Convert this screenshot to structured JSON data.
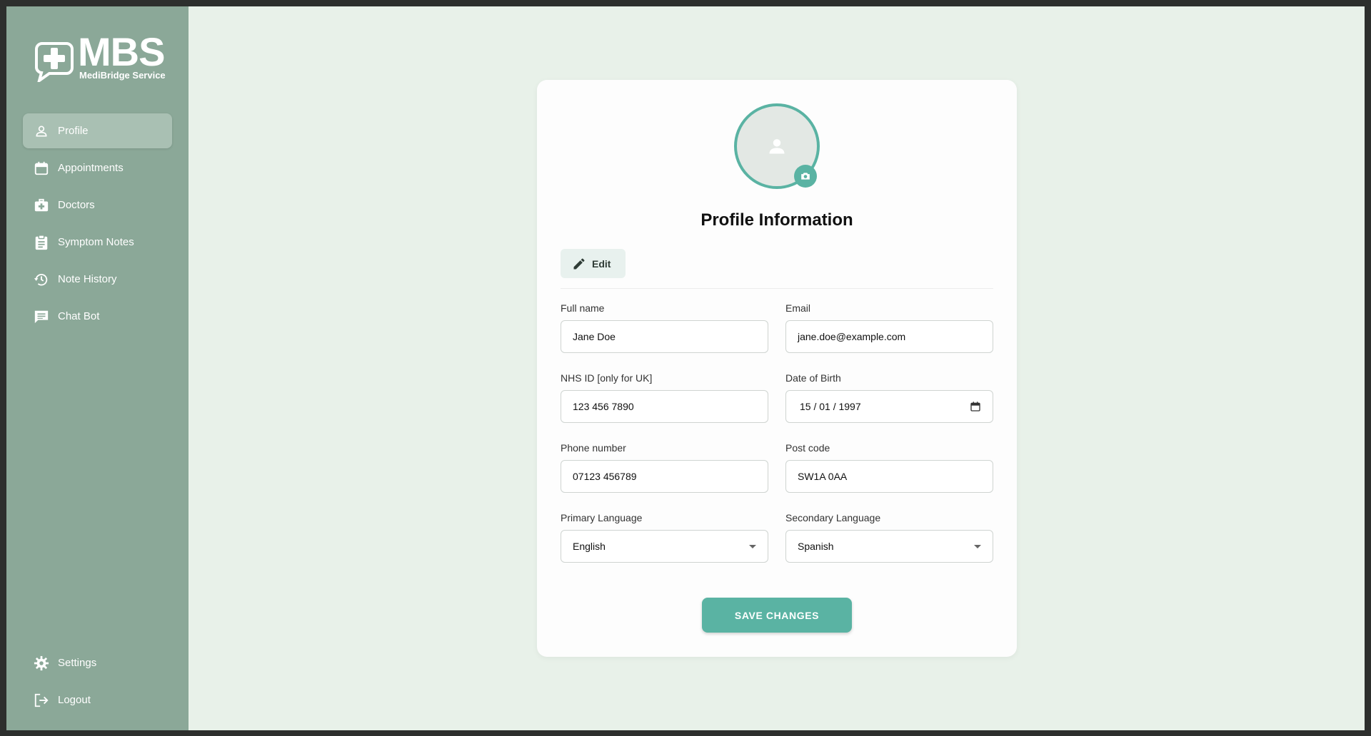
{
  "brand": {
    "logo_text": "MBS",
    "logo_subtext": "MediBridge Service"
  },
  "sidebar": {
    "items": [
      {
        "label": "Profile",
        "icon": "person-icon",
        "active": true
      },
      {
        "label": "Appointments",
        "icon": "calendar-icon"
      },
      {
        "label": "Doctors",
        "icon": "medical-bag-icon"
      },
      {
        "label": "Symptom Notes",
        "icon": "clipboard-icon"
      },
      {
        "label": "Note History",
        "icon": "history-icon"
      },
      {
        "label": "Chat Bot",
        "icon": "chat-icon"
      }
    ],
    "bottom_items": [
      {
        "label": "Settings",
        "icon": "gear-icon"
      },
      {
        "label": "Logout",
        "icon": "logout-icon"
      }
    ]
  },
  "profile": {
    "title": "Profile Information",
    "edit_label": "Edit",
    "fields": {
      "full_name": {
        "label": "Full name",
        "value": "Jane Doe"
      },
      "email": {
        "label": "Email",
        "value": "jane.doe@example.com"
      },
      "nhs_id": {
        "label": "NHS ID [only for UK]",
        "value": "123 456 7890"
      },
      "dob": {
        "label": "Date of Birth",
        "value": "15 / 01 / 1997"
      },
      "phone": {
        "label": "Phone number",
        "value": "07123 456789"
      },
      "postcode": {
        "label": "Post code",
        "value": "SW1A 0AA"
      },
      "primary_language": {
        "label": "Primary Language",
        "value": "English"
      },
      "secondary_language": {
        "label": "Secondary Language",
        "value": "Spanish"
      }
    },
    "save_label": "SAVE CHANGES"
  },
  "colors": {
    "sidebar_bg": "#8ba898",
    "sidebar_active": "#a9c0b3",
    "accent": "#5ab3a3",
    "main_bg": "#e8f1e9"
  }
}
